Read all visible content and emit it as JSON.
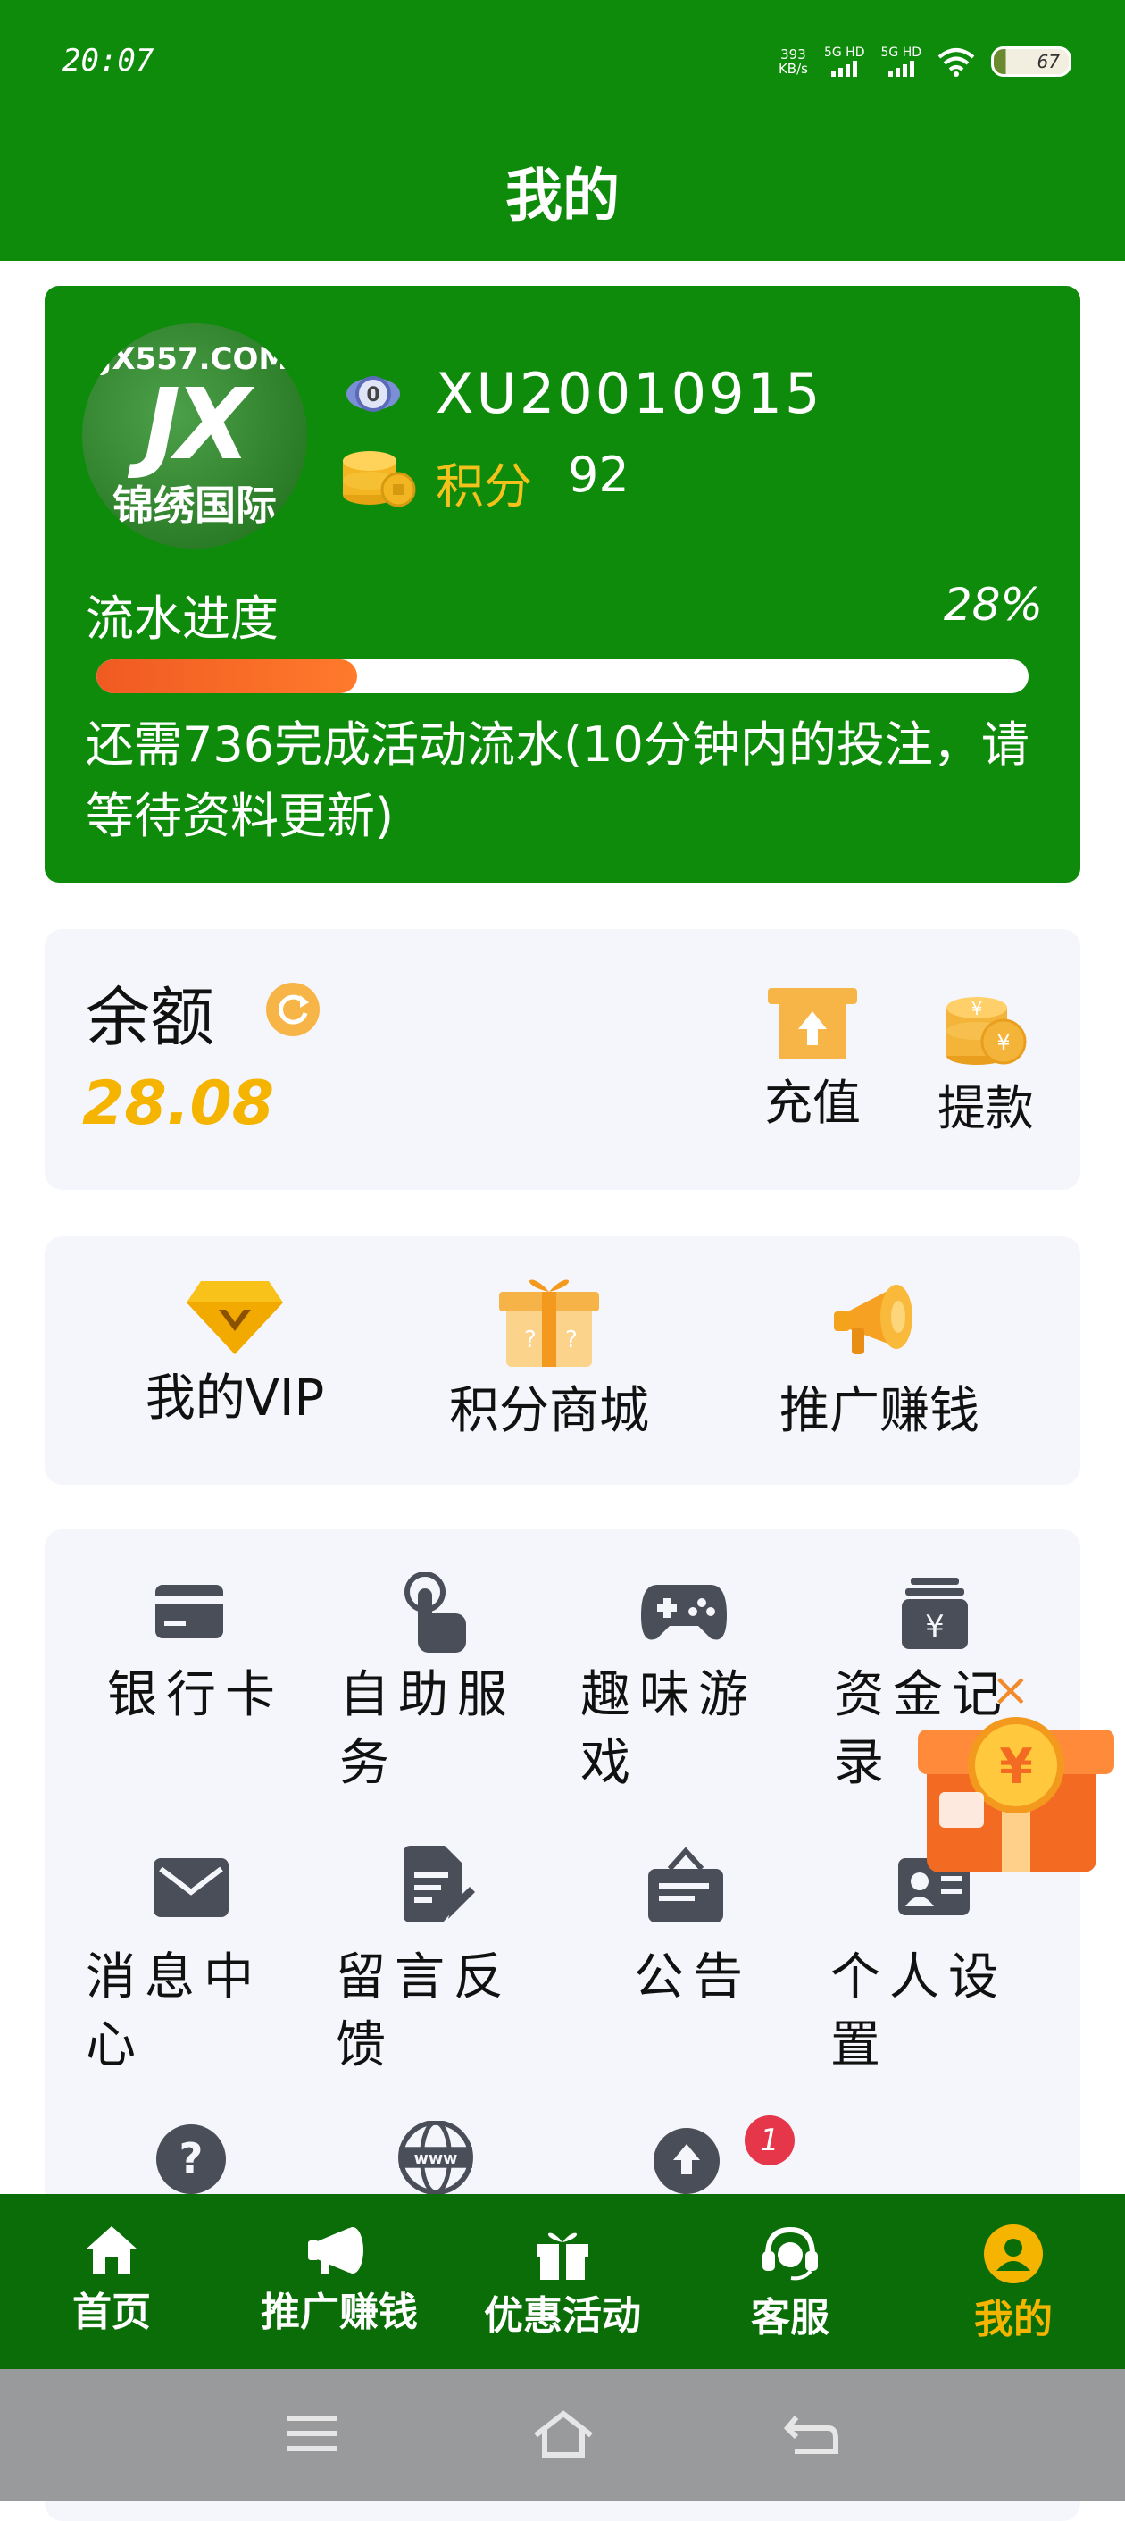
{
  "status_bar": {
    "time": "20:07",
    "speed_value": "393",
    "speed_unit": "KB/s",
    "signal1": "5G HD",
    "signal2": "5G HD",
    "battery": "67"
  },
  "header": {
    "title": "我的"
  },
  "user": {
    "avatar_line1": "JX557.COM",
    "avatar_line2": "JX",
    "avatar_line3": "锦绣国际",
    "user_id": "XU20010915",
    "points_label": "积分",
    "points_value": "92",
    "flow_label": "流水进度",
    "flow_percent_text": "28%",
    "flow_progress": 0.28,
    "flow_note": "还需736完成活动流水(10分钟内的投注，请等待资料更新)"
  },
  "balance": {
    "label": "余额",
    "value": "28.08",
    "recharge_label": "充值",
    "withdraw_label": "提款"
  },
  "quick": [
    {
      "label": "我的VIP",
      "icon": "vip-diamond-icon"
    },
    {
      "label": "积分商城",
      "icon": "gift-box-icon"
    },
    {
      "label": "推广赚钱",
      "icon": "megaphone-icon"
    }
  ],
  "menu": {
    "bank_card": "银行卡",
    "self_service": "自助服务",
    "fun_games": "趣味游戏",
    "fund_records": "资金记录",
    "messages": "消息中心",
    "feedback": "留言反馈",
    "notice": "公告",
    "personal_settings": "个人设置",
    "badge_count": "1"
  },
  "tabs": [
    {
      "label": "首页",
      "icon": "home-icon"
    },
    {
      "label": "推广赚钱",
      "icon": "megaphone-icon"
    },
    {
      "label": "优惠活动",
      "icon": "gift-icon"
    },
    {
      "label": "客服",
      "icon": "headset-icon"
    },
    {
      "label": "我的",
      "icon": "user-icon",
      "active": true
    }
  ],
  "colors": {
    "brand_green": "#0f8b0b",
    "tabbar_green": "#0a6d07",
    "accent_gold": "#f5b400",
    "progress_orange": "#f05a22"
  }
}
